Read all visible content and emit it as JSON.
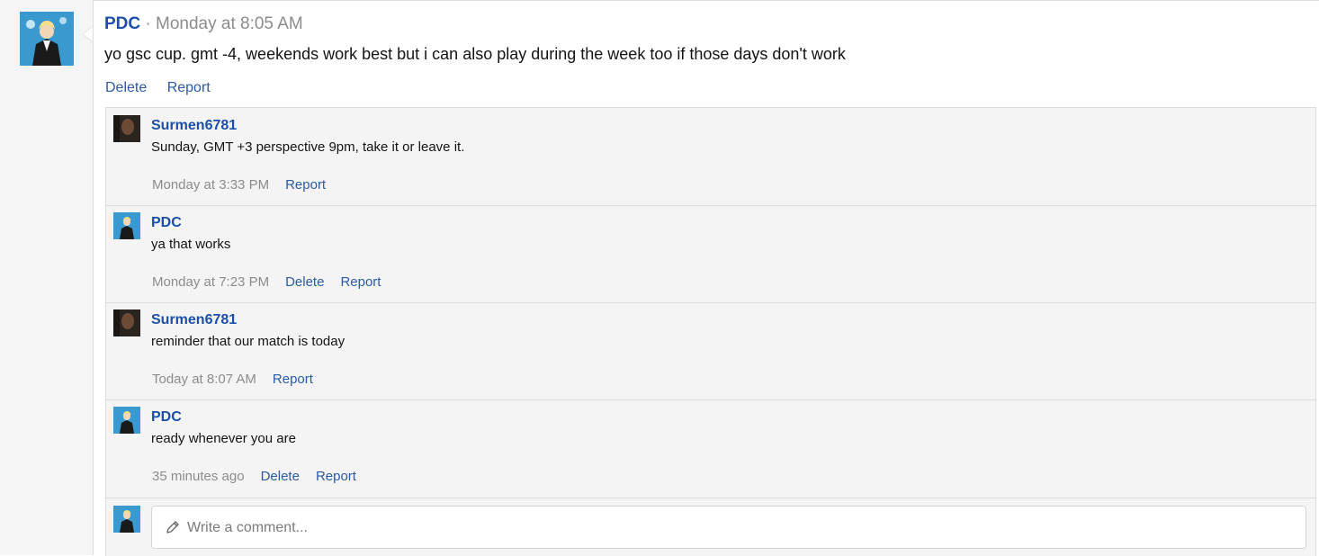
{
  "post": {
    "author": "PDC",
    "separator": " · ",
    "time": "Monday at 8:05 AM",
    "body": "yo gsc cup. gmt -4, weekends work best but i can also play during the week too if those days don't work",
    "actions": [
      "Delete",
      "Report"
    ]
  },
  "comments": [
    {
      "author": "Surmen6781",
      "avatar": "dark-portrait",
      "text": "Sunday, GMT +3 perspective 9pm, take it or leave it.",
      "time": "Monday at 3:33 PM",
      "actions": [
        "Report"
      ]
    },
    {
      "author": "PDC",
      "avatar": "anime-avatar",
      "text": "ya that works",
      "time": "Monday at 7:23 PM",
      "actions": [
        "Delete",
        "Report"
      ]
    },
    {
      "author": "Surmen6781",
      "avatar": "dark-portrait",
      "text": "reminder that our match is today",
      "time": "Today at 8:07 AM",
      "actions": [
        "Report"
      ]
    },
    {
      "author": "PDC",
      "avatar": "anime-avatar",
      "text": "ready whenever you are",
      "time": "35 minutes ago",
      "actions": [
        "Delete",
        "Report"
      ]
    }
  ],
  "reply": {
    "placeholder": "Write a comment...",
    "icon": "pencil-icon"
  },
  "colors": {
    "link": "#2b5aa8",
    "username": "#1d4fa8",
    "muted": "#8c8c8c",
    "panel": "#f4f4f4"
  }
}
